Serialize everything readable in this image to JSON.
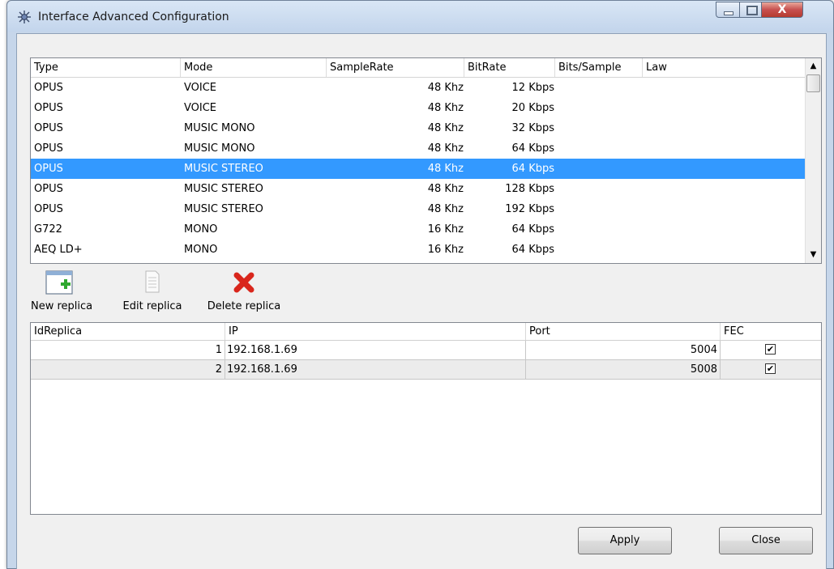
{
  "window": {
    "title": "Interface Advanced Configuration",
    "controls": {
      "close_glyph": "X"
    }
  },
  "codecs": {
    "columns": [
      "Type",
      "Mode",
      "SampleRate",
      "BitRate",
      "Bits/Sample",
      "Law"
    ],
    "selected_index": 4,
    "rows": [
      {
        "type": "OPUS",
        "mode": "VOICE",
        "samplerate": "48 Khz",
        "bitrate": "12 Kbps",
        "bits": "",
        "law": ""
      },
      {
        "type": "OPUS",
        "mode": "VOICE",
        "samplerate": "48 Khz",
        "bitrate": "20 Kbps",
        "bits": "",
        "law": ""
      },
      {
        "type": "OPUS",
        "mode": "MUSIC MONO",
        "samplerate": "48 Khz",
        "bitrate": "32 Kbps",
        "bits": "",
        "law": ""
      },
      {
        "type": "OPUS",
        "mode": "MUSIC MONO",
        "samplerate": "48 Khz",
        "bitrate": "64 Kbps",
        "bits": "",
        "law": ""
      },
      {
        "type": "OPUS",
        "mode": "MUSIC STEREO",
        "samplerate": "48 Khz",
        "bitrate": "64 Kbps",
        "bits": "",
        "law": ""
      },
      {
        "type": "OPUS",
        "mode": "MUSIC STEREO",
        "samplerate": "48 Khz",
        "bitrate": "128 Kbps",
        "bits": "",
        "law": ""
      },
      {
        "type": "OPUS",
        "mode": "MUSIC STEREO",
        "samplerate": "48 Khz",
        "bitrate": "192 Kbps",
        "bits": "",
        "law": ""
      },
      {
        "type": "G722",
        "mode": "MONO",
        "samplerate": "16 Khz",
        "bitrate": "64 Kbps",
        "bits": "",
        "law": ""
      },
      {
        "type": "AEQ LD+",
        "mode": "MONO",
        "samplerate": "16 Khz",
        "bitrate": "64 Kbps",
        "bits": "",
        "law": ""
      }
    ],
    "scroll_up_glyph": "▲",
    "scroll_down_glyph": "▼"
  },
  "toolbar": {
    "new_label": "New replica",
    "edit_label": "Edit replica",
    "delete_label": "Delete replica",
    "new_icon": "new-replica-icon",
    "edit_icon": "document-icon",
    "delete_icon": "red-x-icon"
  },
  "replicas": {
    "columns": [
      "IdReplica",
      "IP",
      "Port",
      "FEC"
    ],
    "rows": [
      {
        "id": "1",
        "ip": "192.168.1.69",
        "port": "5004",
        "fec": true
      },
      {
        "id": "2",
        "ip": "192.168.1.69",
        "port": "5008",
        "fec": true
      }
    ],
    "check_glyph": "✔"
  },
  "buttons": {
    "apply_label": "Apply",
    "close_label": "Close"
  },
  "colors": {
    "selection": "#3399ff",
    "delete_icon": "#d9261c",
    "new_icon_plus": "#2fa82f"
  }
}
